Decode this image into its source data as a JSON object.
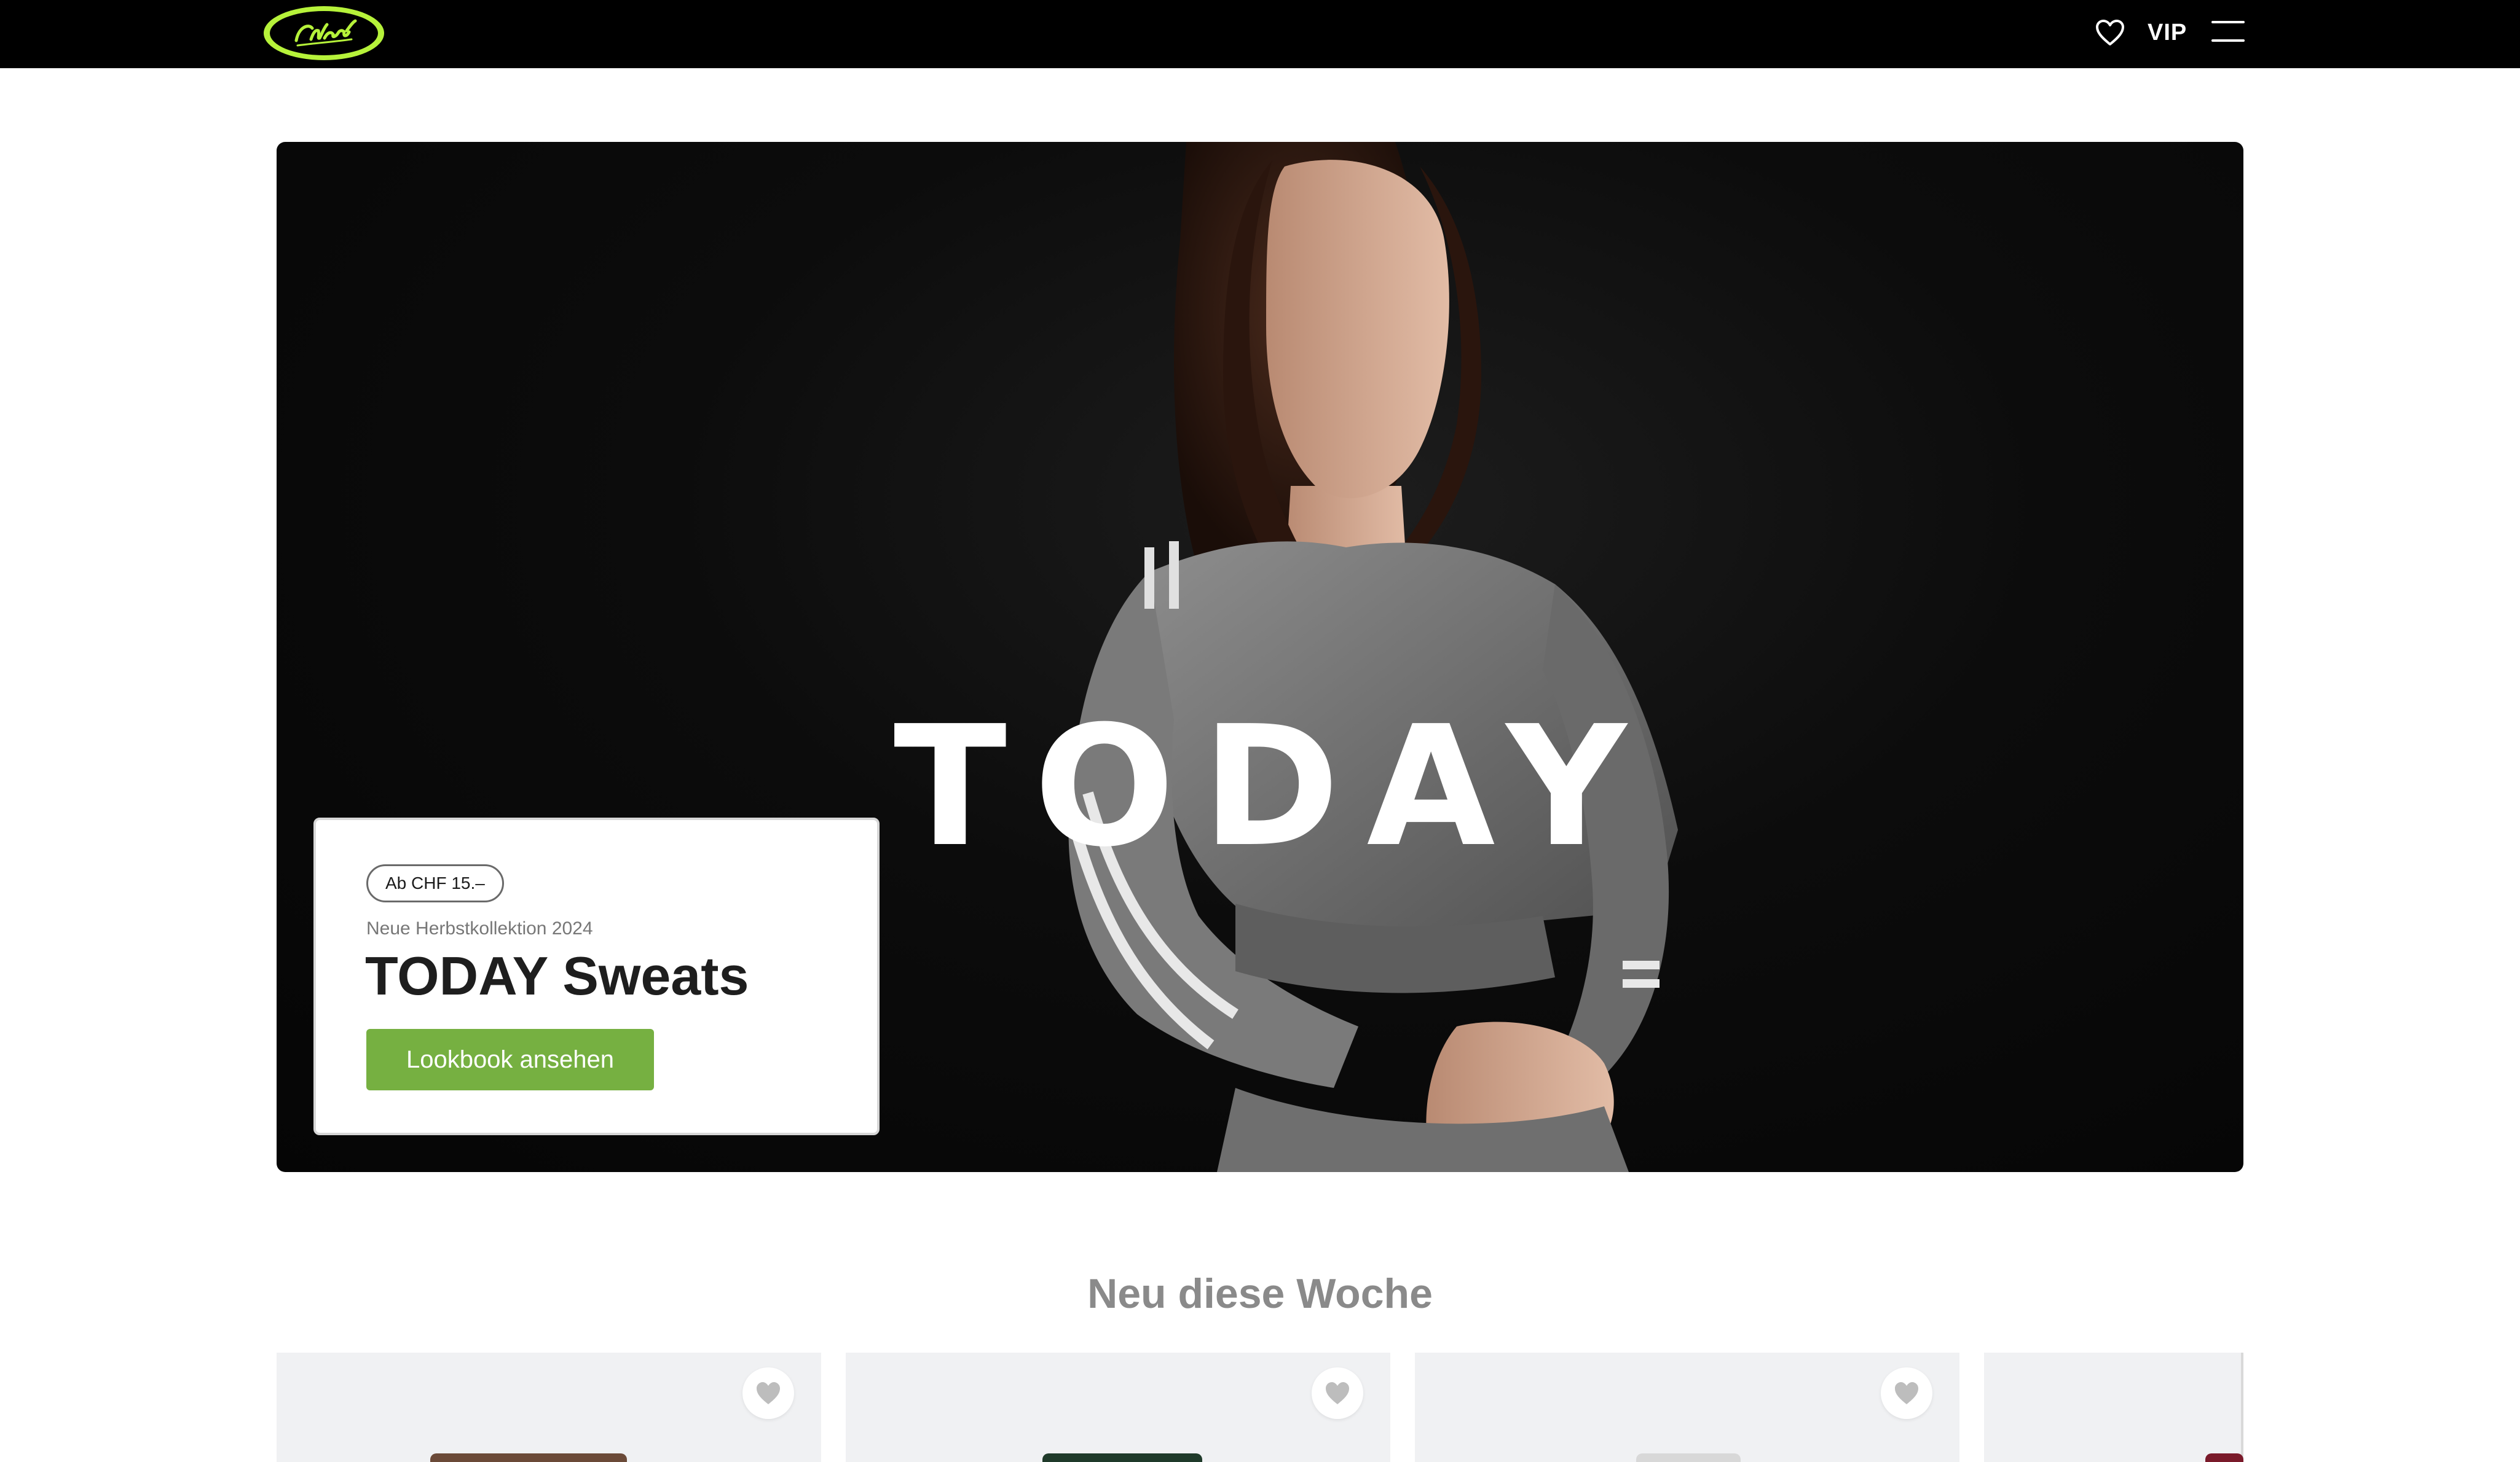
{
  "header": {
    "logo_text": "Chicorée",
    "wishlist_icon": "heart-outline-icon",
    "vip_label": "VIP",
    "menu_icon": "hamburger-menu-icon"
  },
  "hero": {
    "word": "TODAY",
    "promo": {
      "price_badge": "Ab CHF 15.–",
      "eyebrow": "Neue Herbstkollektion 2024",
      "title": "TODAY Sweats",
      "cta_label": "Lookbook ansehen"
    }
  },
  "new_this_week": {
    "title": "Neu diese Woche",
    "products": [
      {
        "favorite_icon": "heart-icon",
        "image_hint": "brown garment"
      },
      {
        "favorite_icon": "heart-icon",
        "image_hint": "dark green garment"
      },
      {
        "favorite_icon": "heart-icon",
        "image_hint": "light grey garment"
      },
      {
        "favorite_icon": "heart-icon",
        "image_hint": "burgundy garment"
      }
    ]
  },
  "colors": {
    "topbar_bg": "#000000",
    "logo_green": "#b6f23a",
    "cta_green": "#76b041",
    "section_title": "#8a8a8a",
    "product_bg": "#f0f1f3"
  }
}
